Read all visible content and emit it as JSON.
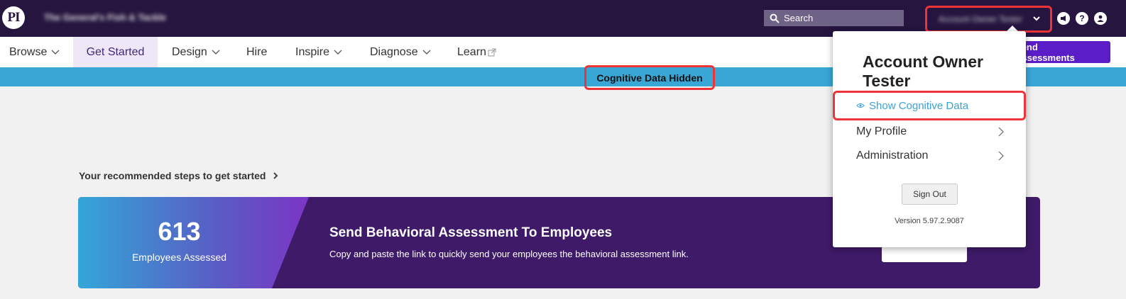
{
  "header": {
    "logo_text": "PI",
    "org_name": "The General's Fish & Tackle",
    "search_placeholder": "Search",
    "account_name": "Account Owner Tester"
  },
  "nav": {
    "items": [
      {
        "label": "Browse"
      },
      {
        "label": "Get Started"
      },
      {
        "label": "Design"
      },
      {
        "label": "Hire"
      },
      {
        "label": "Inspire"
      },
      {
        "label": "Diagnose"
      },
      {
        "label": "Learn"
      }
    ],
    "send_button": "Send Assessments"
  },
  "banner": {
    "text": "Cognitive Data Hidden"
  },
  "steps": {
    "link_text": "Your recommended steps to get started"
  },
  "card": {
    "count": "613",
    "count_label": "Employees Assessed",
    "title": "Send Behavioral Assessment To Employees",
    "description": "Copy and paste the link to quickly send your employees the behavioral assessment link."
  },
  "dropdown": {
    "name": "Account Owner Tester",
    "show_cognitive": "Show Cognitive Data",
    "my_profile": "My Profile",
    "administration": "Administration",
    "sign_out": "Sign Out",
    "version": "Version 5.97.2.9087"
  },
  "colors": {
    "topbar": "#25153f",
    "banner": "#38a7d6",
    "highlight": "#ee3438",
    "accent_purple": "#5a1dc8"
  }
}
